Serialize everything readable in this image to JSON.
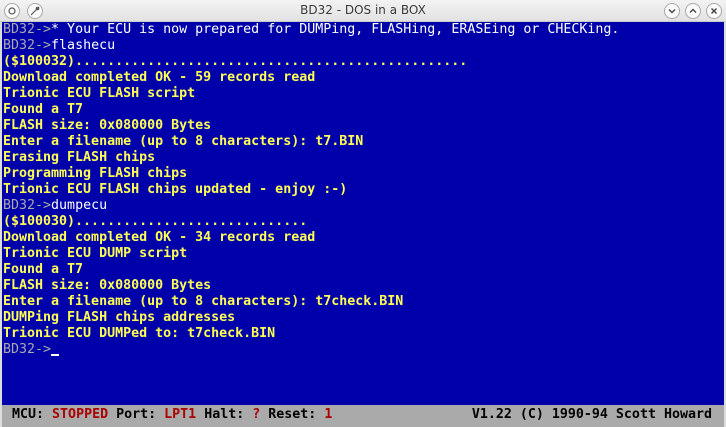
{
  "window": {
    "title": "BD32 - DOS in a BOX"
  },
  "colors": {
    "console_bg": "#0000aa",
    "console_text": "#ffff55",
    "prompt_text": "#aaaaaa",
    "status_bg": "#aaaaaa",
    "status_value": "#aa0000"
  },
  "console": {
    "lines": [
      {
        "prompt": "BD32->",
        "text": "* Your ECU is now prepared for DUMPing, FLASHing, ERASEing or CHECKing."
      },
      {
        "prompt": "BD32->",
        "text": "flashecu"
      },
      {
        "prompt": "",
        "text": "($100032)................................................."
      },
      {
        "prompt": "",
        "text": "Download completed OK - 59 records read"
      },
      {
        "prompt": "",
        "text": "Trionic ECU FLASH script"
      },
      {
        "prompt": "",
        "text": "Found a T7"
      },
      {
        "prompt": "",
        "text": "FLASH size: 0x080000 Bytes"
      },
      {
        "prompt": "",
        "text": "Enter a filename (up to 8 characters): t7.BIN"
      },
      {
        "prompt": "",
        "text": "Erasing FLASH chips"
      },
      {
        "prompt": "",
        "text": "Programming FLASH chips"
      },
      {
        "prompt": "",
        "text": "Trionic ECU FLASH chips updated - enjoy :-)"
      },
      {
        "prompt": "BD32->",
        "text": "dumpecu"
      },
      {
        "prompt": "",
        "text": "($100030)............................."
      },
      {
        "prompt": "",
        "text": "Download completed OK - 34 records read"
      },
      {
        "prompt": "",
        "text": "Trionic ECU DUMP script"
      },
      {
        "prompt": "",
        "text": "Found a T7"
      },
      {
        "prompt": "",
        "text": "FLASH size: 0x080000 Bytes"
      },
      {
        "prompt": "",
        "text": "Enter a filename (up to 8 characters): t7check.BIN"
      },
      {
        "prompt": "",
        "text": "DUMPing FLASH chips addresses"
      },
      {
        "prompt": "",
        "text": "Trionic ECU DUMPed to: t7check.BIN"
      }
    ],
    "current_prompt": "BD32->"
  },
  "status": {
    "mcu_label": "MCU:",
    "mcu_value": "STOPPED",
    "port_label": "Port:",
    "port_value": "LPT1",
    "halt_label": "Halt:",
    "halt_value": "?",
    "reset_label": "Reset:",
    "reset_value": "1",
    "version": "V1.22 (C) 1990-94 Scott Howard"
  },
  "icons": {
    "menu": "window-menu-icon",
    "pin": "keep-above-icon",
    "minimize": "minimize-icon",
    "maximize": "maximize-icon",
    "close": "close-icon"
  }
}
